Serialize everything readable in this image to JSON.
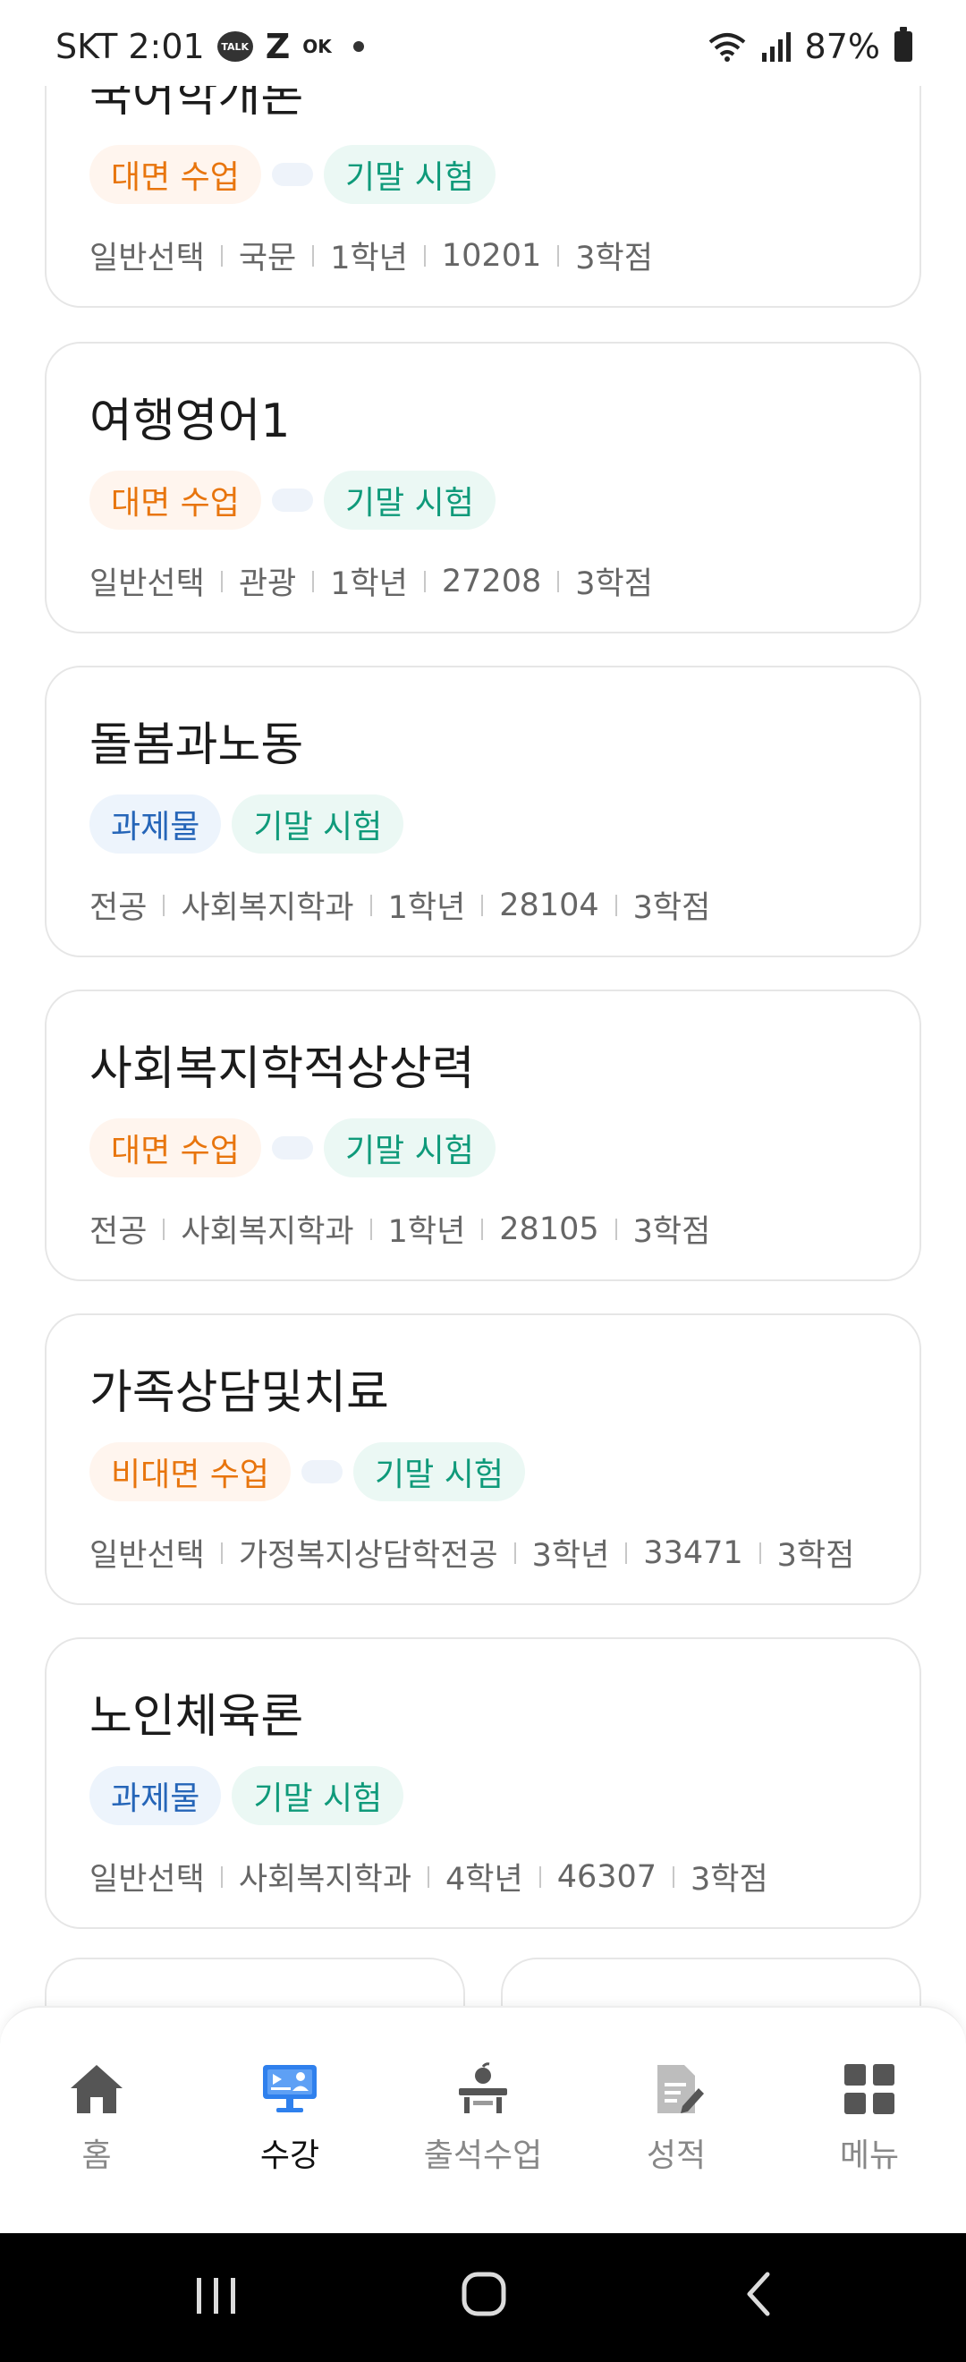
{
  "status_bar": {
    "carrier_time": "SKT 2:01",
    "talk_badge": "TALK",
    "z_icon": "Z",
    "ok_icon": "OK",
    "battery": "87%",
    "icons": [
      "kakaotalk-icon",
      "z-icon",
      "ok-icon",
      "wifi-icon",
      "signal-icon",
      "battery-icon"
    ]
  },
  "courses": [
    {
      "title": "국어학개론",
      "tags": [
        {
          "label": "대면 수업",
          "kind": "orange"
        },
        {
          "label": "",
          "kind": "empty"
        },
        {
          "label": "기말 시험",
          "kind": "teal"
        }
      ],
      "meta": [
        "일반선택",
        "국문",
        "1학년",
        "10201",
        "3학점"
      ]
    },
    {
      "title": "여행영어1",
      "tags": [
        {
          "label": "대면 수업",
          "kind": "orange"
        },
        {
          "label": "",
          "kind": "empty"
        },
        {
          "label": "기말 시험",
          "kind": "teal"
        }
      ],
      "meta": [
        "일반선택",
        "관광",
        "1학년",
        "27208",
        "3학점"
      ]
    },
    {
      "title": "돌봄과노동",
      "tags": [
        {
          "label": "과제물",
          "kind": "blue"
        },
        {
          "label": "기말 시험",
          "kind": "teal"
        }
      ],
      "meta": [
        "전공",
        "사회복지학과",
        "1학년",
        "28104",
        "3학점"
      ]
    },
    {
      "title": "사회복지학적상상력",
      "tags": [
        {
          "label": "대면 수업",
          "kind": "orange"
        },
        {
          "label": "",
          "kind": "empty"
        },
        {
          "label": "기말 시험",
          "kind": "teal"
        }
      ],
      "meta": [
        "전공",
        "사회복지학과",
        "1학년",
        "28105",
        "3학점"
      ]
    },
    {
      "title": "가족상담및치료",
      "tags": [
        {
          "label": "비대면 수업",
          "kind": "orange"
        },
        {
          "label": "",
          "kind": "empty"
        },
        {
          "label": "기말 시험",
          "kind": "teal"
        }
      ],
      "meta": [
        "일반선택",
        "가정복지상담학전공",
        "3학년",
        "33471",
        "3학점"
      ]
    },
    {
      "title": "노인체육론",
      "tags": [
        {
          "label": "과제물",
          "kind": "blue"
        },
        {
          "label": "기말 시험",
          "kind": "teal"
        }
      ],
      "meta": [
        "일반선택",
        "사회복지학과",
        "4학년",
        "46307",
        "3학점"
      ]
    }
  ],
  "bottom_nav": {
    "active_index": 1,
    "active_color": "#111111",
    "inactive_color": "#888888",
    "items": [
      {
        "label": "홈",
        "icon": "home-icon"
      },
      {
        "label": "수강",
        "icon": "lecture-icon"
      },
      {
        "label": "출석수업",
        "icon": "attendance-class-icon"
      },
      {
        "label": "성적",
        "icon": "grades-icon"
      },
      {
        "label": "메뉴",
        "icon": "menu-grid-icon"
      }
    ]
  },
  "system_nav": {
    "buttons": [
      "recent-apps-icon",
      "home-button-icon",
      "back-icon"
    ]
  },
  "colors": {
    "tag_orange_text": "#e8750d",
    "tag_blue_text": "#2565b8",
    "tag_teal_text": "#0f9a7a",
    "lecture_icon_accent": "#2f80ed"
  }
}
